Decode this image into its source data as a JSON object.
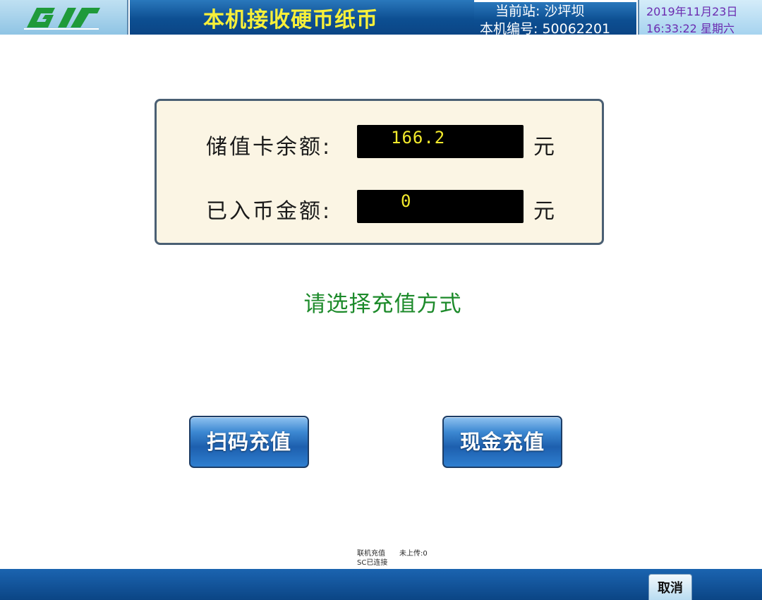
{
  "header": {
    "title": "本机接收硬币纸币",
    "station_line": "当前站: 沙坪坝",
    "machine_line": "本机编号: 50062201",
    "date": "2019年11月23日",
    "time_weekday": "16:33:22  星期六",
    "logo_icon": "transit-logo-icon"
  },
  "panel": {
    "balance_label": "储值卡余额:",
    "balance_value": "166.2",
    "balance_unit": "元",
    "inserted_label": "已入币金额:",
    "inserted_value": "0",
    "inserted_unit": "元"
  },
  "prompt": "请选择充值方式",
  "buttons": {
    "scan_recharge": "扫码充值",
    "cash_recharge": "现金充值",
    "cancel": "取消"
  },
  "status": {
    "online_recharge": "联机充值",
    "sc_connected": "SC已连接",
    "not_uploaded": "未上传:0"
  },
  "colors": {
    "title_yellow": "#f7ef3a",
    "header_blue": "#0d4f92",
    "prompt_green": "#1c8a2a",
    "value_yellow": "#f3ea2c",
    "date_purple": "#6b2bb0"
  }
}
